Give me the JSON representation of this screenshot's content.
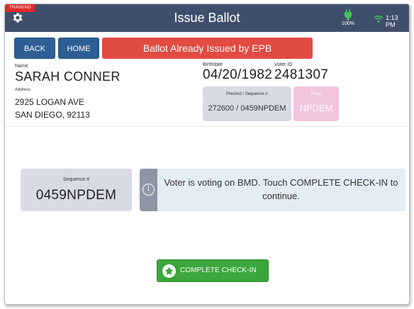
{
  "header": {
    "training_tag": "TRAINING",
    "title": "Issue Ballot",
    "battery_pct": "100%",
    "time": "1:13 PM",
    "colors": {
      "bar": "#3f4f6b",
      "battery": "#43c25a",
      "wifi": "#43c25a",
      "training": "#e02b2b"
    }
  },
  "nav": {
    "back_label": "BACK",
    "home_label": "HOME",
    "alert_label": "Ballot Already Issued by EPB"
  },
  "voter": {
    "name_label": "Name",
    "name": "SARAH CONNER",
    "birthdate_label": "Birthdate",
    "birthdate": "04/20/1982",
    "voter_id_label": "Voter ID",
    "voter_id": "2481307",
    "address_label": "Address",
    "address_line1": "2925 LOGAN AVE",
    "address_line2": "SAN DIEGO, 92113",
    "precinct_label": "Precinct / Sequence #",
    "precinct": "272600 / 0459NPDEM",
    "party_label": "Party",
    "party": "NPDEM"
  },
  "sequence": {
    "label": "Sequence #",
    "value": "0459NPDEM"
  },
  "info": {
    "icon": "info-icon",
    "message": "Voter is voting on BMD. Touch COMPLETE CHECK-IN to continue."
  },
  "action": {
    "complete_label": "COMPLETE CHECK-IN",
    "icon": "star-icon",
    "color": "#3ba63b"
  }
}
